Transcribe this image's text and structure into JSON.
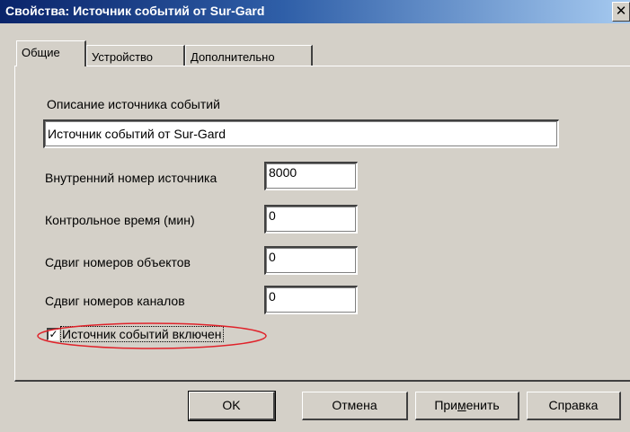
{
  "window": {
    "title": "Свойства: Источник событий от Sur-Gard",
    "close_glyph": "✕"
  },
  "tabs": [
    {
      "label": "Общие",
      "active": true
    },
    {
      "label": "Устройство",
      "active": false
    },
    {
      "label": "Дополнительно",
      "active": false
    }
  ],
  "form": {
    "description_label": "Описание источника событий",
    "description_value": "Источник событий от Sur-Gard",
    "internal_number_label": "Внутренний номер источника",
    "internal_number_value": "8000",
    "control_time_label": "Контрольное время (мин)",
    "control_time_value": "0",
    "object_shift_label": "Сдвиг номеров объектов",
    "object_shift_value": "0",
    "channel_shift_label": "Сдвиг номеров каналов",
    "channel_shift_value": "0",
    "enabled_label": "Источник событий включен",
    "enabled_checked": true,
    "check_glyph": "✓"
  },
  "buttons": {
    "ok": "OK",
    "cancel": "Отмена",
    "apply_pre": "При",
    "apply_ul": "м",
    "apply_post": "енить",
    "help": "Справка"
  },
  "annotation": {
    "color": "#e0222a"
  }
}
